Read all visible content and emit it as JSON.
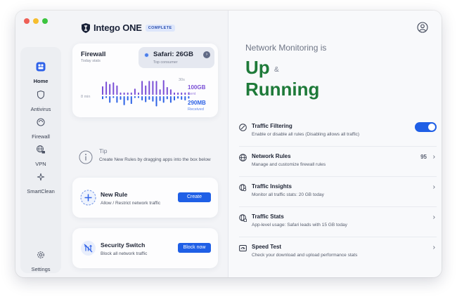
{
  "app": {
    "name": "Intego ONE",
    "badge": "COMPLETE"
  },
  "sidebar": {
    "items": [
      {
        "label": "Home",
        "icon": "home-icon",
        "active": true
      },
      {
        "label": "Antivirus",
        "icon": "shield-icon",
        "active": false
      },
      {
        "label": "Firewall",
        "icon": "firewall-icon",
        "active": false
      },
      {
        "label": "VPN",
        "icon": "globe-lock-icon",
        "active": false
      },
      {
        "label": "SmartClean",
        "icon": "sparkle-icon",
        "active": false
      }
    ],
    "settings_label": "Settings"
  },
  "firewall_card": {
    "title": "Firewall",
    "subtitle": "Today stats",
    "top_consumer": {
      "value": "Safari: 26GB",
      "label": "Top consumer"
    },
    "time_start": "8 min",
    "time_end": "30s",
    "sent_value": "100GB",
    "sent_label": "Sent",
    "received_value": "290MB",
    "received_label": "Received",
    "sent_bars": [
      0.55,
      0.85,
      0.7,
      0.8,
      0.6,
      0.15,
      0.15,
      0.15,
      0.15,
      0.4,
      0.15,
      0.9,
      0.6,
      0.9,
      0.9,
      0.9,
      0.35,
      0.95,
      0.5,
      0.35,
      0.15,
      0.15,
      0.15,
      0.15,
      0.15
    ],
    "received_bars": [
      0.25,
      0.15,
      0.55,
      0.15,
      0.55,
      0.3,
      0.75,
      0.35,
      0.65,
      0.15,
      0.15,
      0.35,
      0.5,
      0.3,
      0.45,
      0.85,
      0.4,
      0.55,
      0.25,
      0.55,
      0.35,
      0.2,
      0.3,
      0.35,
      0.2
    ],
    "colors": {
      "sent": "#7a4fd6",
      "received": "#2e63e6"
    }
  },
  "tip": {
    "title": "Tip",
    "text": "Create New Rules by dragging apps into the box below"
  },
  "new_rule": {
    "title": "New Rule",
    "text": "Allow / Restrict network traffic",
    "button": "Create"
  },
  "security_switch": {
    "title": "Security Switch",
    "text": "Block all network traffic",
    "button": "Block now"
  },
  "status": {
    "heading": "Network Monitoring is",
    "line1": "Up",
    "amp": "&",
    "line2": "Running",
    "color": "#1e7a39"
  },
  "features": [
    {
      "title": "Traffic Filtering",
      "desc": "Enable or disable all rules (Disabling allows all traffic)",
      "icon": "no-entry-icon",
      "toggle_on": true
    },
    {
      "title": "Network Rules",
      "desc": "Manage and customize firewall rules",
      "icon": "globe-icon",
      "count": "95"
    },
    {
      "title": "Traffic Insights",
      "desc": "Monitor all traffic stats: 20 GB today",
      "icon": "globe-search-icon"
    },
    {
      "title": "Traffic Stats",
      "desc": "App-level usage: Safari leads with 15 GB today",
      "icon": "globe-chart-icon"
    },
    {
      "title": "Speed Test",
      "desc": "Check your download and upload performance stats",
      "icon": "speedometer-icon"
    }
  ],
  "accent": "#1f5fe6"
}
